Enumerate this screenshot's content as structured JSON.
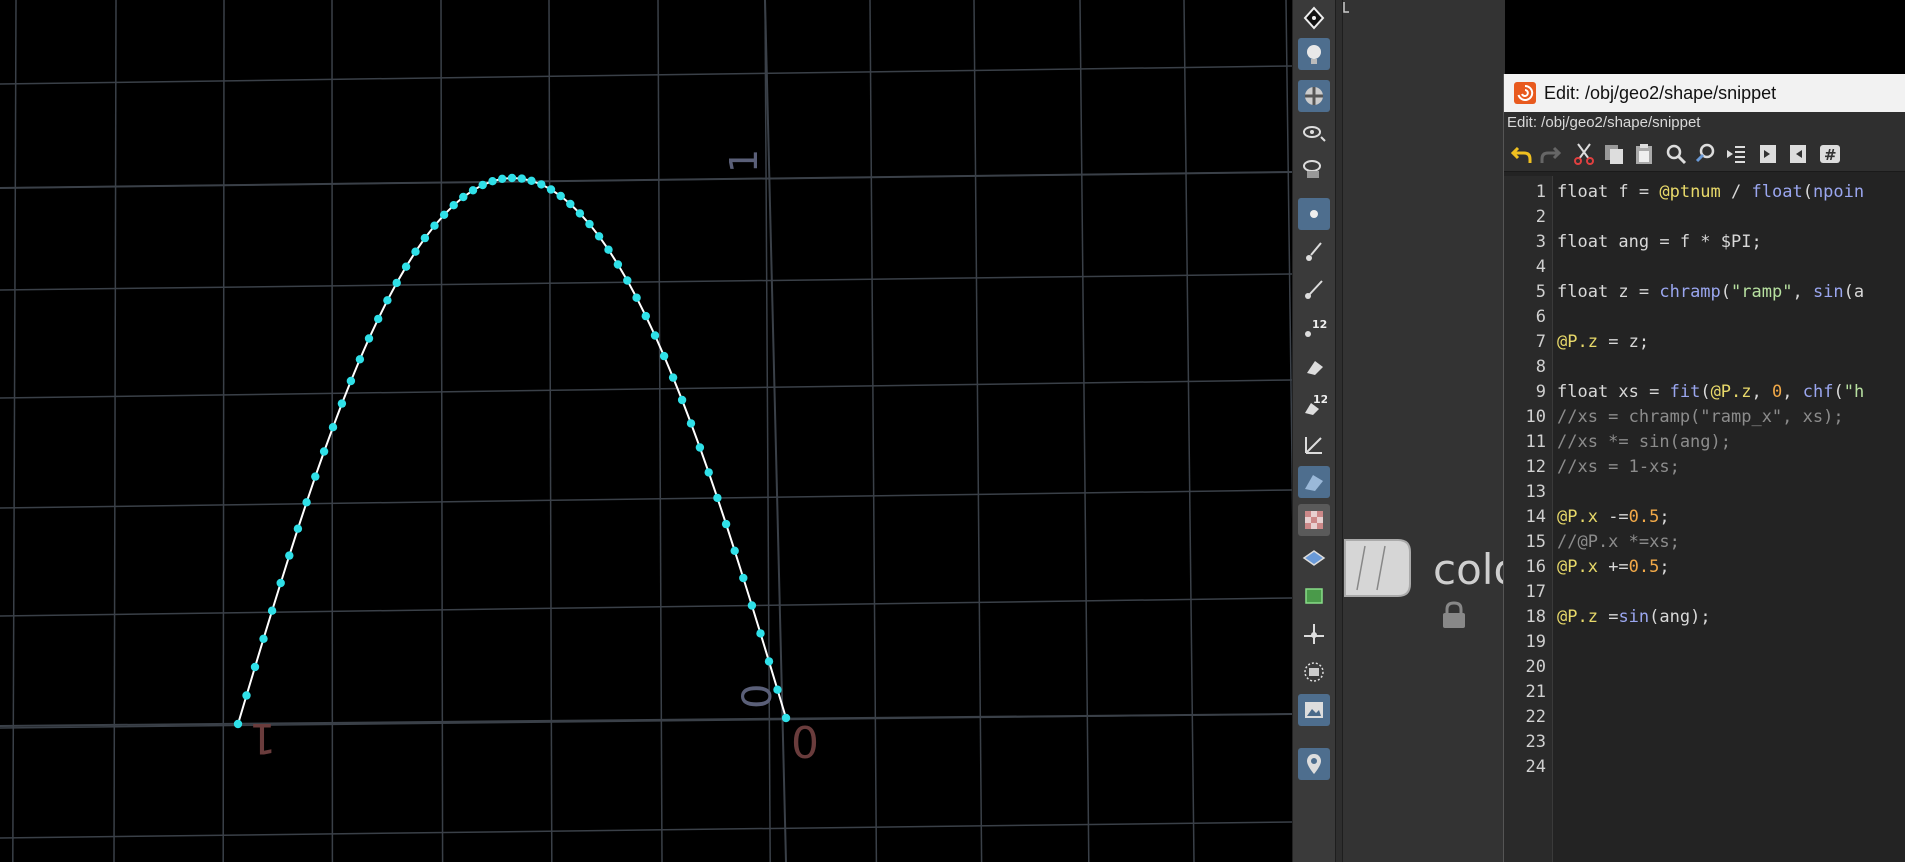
{
  "viewport": {
    "grid_labels": {
      "top_one": "1",
      "mid_zero": "0",
      "left_one": "1",
      "right_zero": "0"
    },
    "colors": {
      "points": "#2fe0e8",
      "curve": "#ffffff",
      "grid": "#3a4048"
    }
  },
  "toolbar": {
    "icons": [
      "handle-icon",
      "light-icon",
      "display-options-icon",
      "view-camera-icon",
      "snap-camera-icon",
      "point-select-icon",
      "brush-icon",
      "pen-icon",
      "point-number-icon",
      "paint-icon",
      "primitive-number-icon",
      "normals-icon",
      "shaded-icon",
      "checker-icon",
      "template-icon",
      "uv-icon",
      "origin-icon",
      "background-icon",
      "image-icon",
      "pin-icon"
    ]
  },
  "network": {
    "node_label": "colo"
  },
  "editor": {
    "window_title": "Edit: /obj/geo2/shape/snippet",
    "subtitle": "Edit: /obj/geo2/shape/snippet",
    "tools": [
      "undo-icon",
      "redo-icon",
      "cut-icon",
      "copy-icon",
      "paste-icon",
      "find-icon",
      "find-replace-icon",
      "indent-icon",
      "bookmark-next-icon",
      "bookmark-prev-icon",
      "comment-icon"
    ],
    "lines": [
      {
        "n": "1",
        "tokens": [
          [
            "kw",
            "float f = "
          ],
          [
            "att",
            "@ptnum"
          ],
          [
            "kw",
            " / "
          ],
          [
            "fn",
            "float"
          ],
          [
            "kw",
            "("
          ],
          [
            "fn",
            "npoin"
          ]
        ]
      },
      {
        "n": "2",
        "tokens": []
      },
      {
        "n": "3",
        "tokens": [
          [
            "kw",
            "float ang = f * $PI;"
          ]
        ]
      },
      {
        "n": "4",
        "tokens": []
      },
      {
        "n": "5",
        "tokens": [
          [
            "kw",
            "float z = "
          ],
          [
            "fn",
            "chramp"
          ],
          [
            "kw",
            "("
          ],
          [
            "str",
            "\"ramp\""
          ],
          [
            "kw",
            ", "
          ],
          [
            "fn",
            "sin"
          ],
          [
            "kw",
            "(a"
          ]
        ]
      },
      {
        "n": "6",
        "tokens": []
      },
      {
        "n": "7",
        "tokens": [
          [
            "att",
            "@P.z"
          ],
          [
            "kw",
            " = z;"
          ]
        ]
      },
      {
        "n": "8",
        "tokens": []
      },
      {
        "n": "9",
        "tokens": [
          [
            "kw",
            "float xs = "
          ],
          [
            "fn",
            "fit"
          ],
          [
            "kw",
            "("
          ],
          [
            "att",
            "@P.z"
          ],
          [
            "kw",
            ", "
          ],
          [
            "num",
            "0"
          ],
          [
            "kw",
            ", "
          ],
          [
            "fn",
            "chf"
          ],
          [
            "kw",
            "("
          ],
          [
            "str",
            "\"h"
          ]
        ]
      },
      {
        "n": "10",
        "tokens": [
          [
            "cm",
            "//xs = chramp(\"ramp_x\", xs);"
          ]
        ]
      },
      {
        "n": "11",
        "tokens": [
          [
            "cm",
            "//xs *= sin(ang);"
          ]
        ]
      },
      {
        "n": "12",
        "tokens": [
          [
            "cm",
            "//xs = 1-xs;"
          ]
        ]
      },
      {
        "n": "13",
        "tokens": []
      },
      {
        "n": "14",
        "tokens": [
          [
            "att",
            "@P.x"
          ],
          [
            "kw",
            " -="
          ],
          [
            "num",
            "0.5"
          ],
          [
            "kw",
            ";"
          ]
        ]
      },
      {
        "n": "15",
        "tokens": [
          [
            "cm",
            "//@P.x *=xs;"
          ]
        ]
      },
      {
        "n": "16",
        "tokens": [
          [
            "att",
            "@P.x"
          ],
          [
            "kw",
            " +="
          ],
          [
            "num",
            "0.5"
          ],
          [
            "kw",
            ";"
          ]
        ]
      },
      {
        "n": "17",
        "tokens": []
      },
      {
        "n": "18",
        "tokens": [
          [
            "att",
            "@P.z"
          ],
          [
            "kw",
            " ="
          ],
          [
            "fn",
            "sin"
          ],
          [
            "kw",
            "(ang);"
          ]
        ]
      },
      {
        "n": "19",
        "tokens": []
      },
      {
        "n": "20",
        "tokens": []
      },
      {
        "n": "21",
        "tokens": []
      },
      {
        "n": "22",
        "tokens": []
      },
      {
        "n": "23",
        "tokens": []
      },
      {
        "n": "24",
        "tokens": []
      }
    ]
  }
}
